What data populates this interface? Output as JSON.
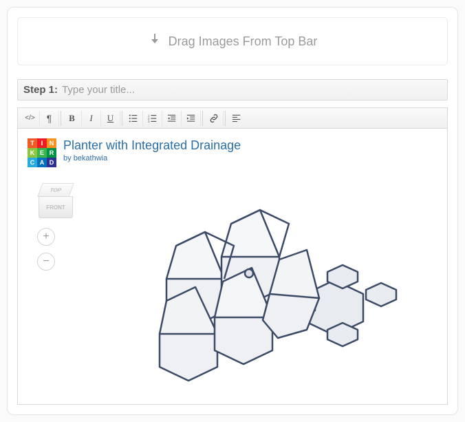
{
  "dropzone": {
    "label": "Drag Images From Top Bar"
  },
  "step": {
    "prefix": "Step 1:",
    "placeholder": "Type your title..."
  },
  "toolbar": {
    "code": "</>",
    "paragraph": "¶",
    "bold": "B",
    "italic": "I",
    "underline": "U"
  },
  "logo_cells": [
    {
      "bg": "#f15a24",
      "t": "T"
    },
    {
      "bg": "#ed1c24",
      "t": "I"
    },
    {
      "bg": "#f7931e",
      "t": "N"
    },
    {
      "bg": "#8cc63f",
      "t": "K"
    },
    {
      "bg": "#39b54a",
      "t": "E"
    },
    {
      "bg": "#009245",
      "t": "R"
    },
    {
      "bg": "#29abe2",
      "t": "C"
    },
    {
      "bg": "#0071bc",
      "t": "A"
    },
    {
      "bg": "#2e3192",
      "t": "D"
    }
  ],
  "embed": {
    "title": "Planter with Integrated Drainage",
    "by_prefix": "by",
    "author": "bekathwia"
  },
  "viewcube": {
    "top": "TOP",
    "front": "FRONT"
  },
  "zoom": {
    "in": "+",
    "out": "−"
  }
}
